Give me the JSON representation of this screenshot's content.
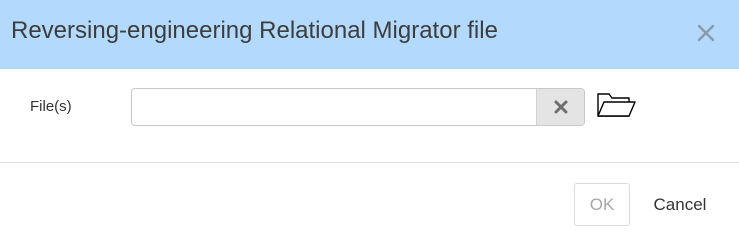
{
  "dialog": {
    "title": "Reversing-engineering Relational Migrator file",
    "close_icon": "close-icon"
  },
  "form": {
    "files_label": "File(s)",
    "files_value": "",
    "clear_icon": "clear-x-icon",
    "browse_icon": "folder-open-icon"
  },
  "footer": {
    "ok_label": "OK",
    "cancel_label": "Cancel"
  },
  "colors": {
    "titlebar_bg": "#b3dafd",
    "ok_disabled_text": "#a8a8a8"
  }
}
